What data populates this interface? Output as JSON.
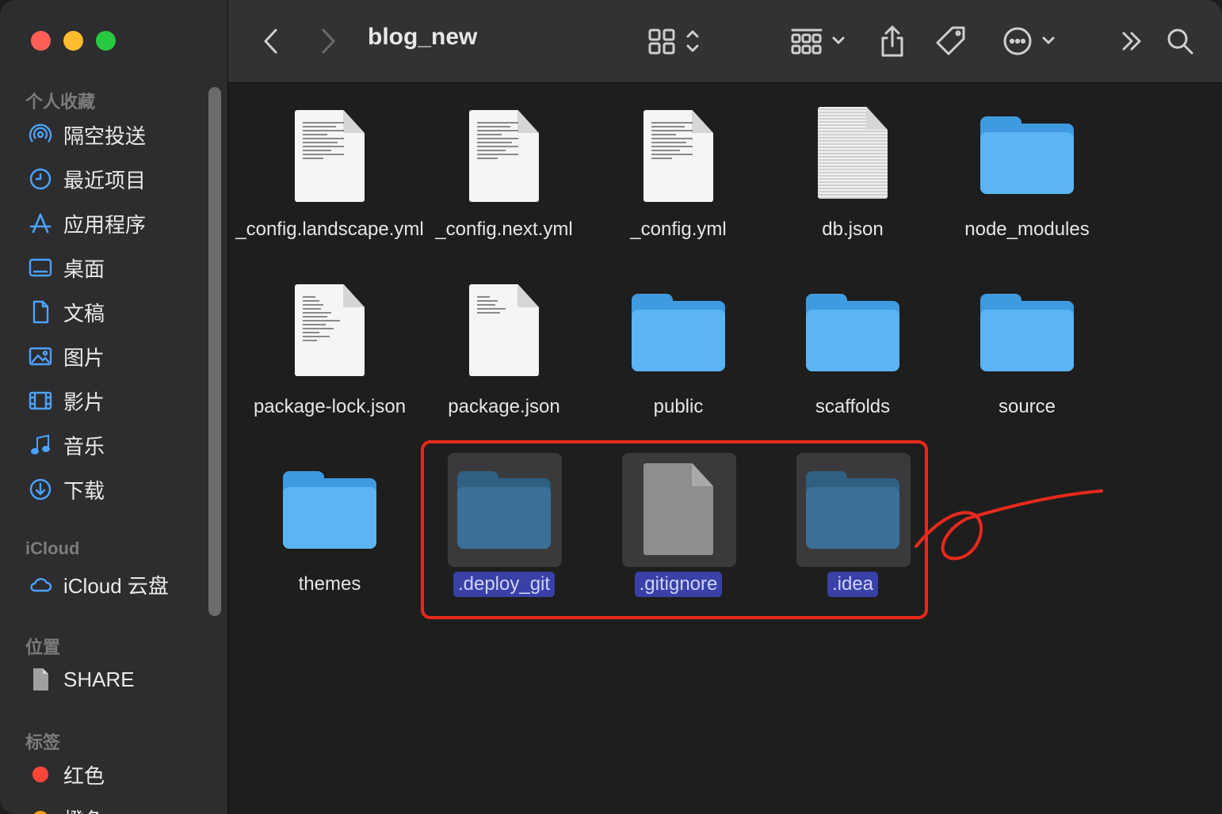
{
  "window": {
    "title": "blog_new"
  },
  "sidebar": {
    "favorites_title": "个人收藏",
    "favorites": [
      {
        "label": "隔空投送",
        "icon": "airdrop-icon"
      },
      {
        "label": "最近项目",
        "icon": "clock-icon"
      },
      {
        "label": "应用程序",
        "icon": "applications-icon"
      },
      {
        "label": "桌面",
        "icon": "desktop-icon"
      },
      {
        "label": "文稿",
        "icon": "document-icon"
      },
      {
        "label": "图片",
        "icon": "photo-icon"
      },
      {
        "label": "影片",
        "icon": "film-icon"
      },
      {
        "label": "音乐",
        "icon": "music-icon"
      },
      {
        "label": "下载",
        "icon": "download-icon"
      }
    ],
    "icloud_title": "iCloud",
    "icloud": [
      {
        "label": "iCloud 云盘",
        "icon": "cloud-icon"
      }
    ],
    "locations_title": "位置",
    "locations": [
      {
        "label": "SHARE",
        "icon": "share-file-icon"
      }
    ],
    "tags_title": "标签",
    "tags": [
      {
        "label": "红色",
        "color": "#ff453a"
      },
      {
        "label": "橙色",
        "color": "#ff9f0a"
      }
    ]
  },
  "files": [
    {
      "name": "_config.landscape.yml",
      "kind": "text-document"
    },
    {
      "name": "_config.next.yml",
      "kind": "text-document"
    },
    {
      "name": "_config.yml",
      "kind": "text-document"
    },
    {
      "name": "db.json",
      "kind": "dense-document"
    },
    {
      "name": "node_modules",
      "kind": "folder"
    },
    {
      "name": "package-lock.json",
      "kind": "code-document"
    },
    {
      "name": "package.json",
      "kind": "code-document"
    },
    {
      "name": "public",
      "kind": "folder"
    },
    {
      "name": "scaffolds",
      "kind": "folder"
    },
    {
      "name": "source",
      "kind": "folder"
    },
    {
      "name": "themes",
      "kind": "folder"
    },
    {
      "name": ".deploy_git",
      "kind": "folder",
      "selected": true
    },
    {
      "name": ".gitignore",
      "kind": "document",
      "selected": true
    },
    {
      "name": ".idea",
      "kind": "folder",
      "selected": true
    }
  ],
  "colors": {
    "accent_selection": "#3a41a6",
    "annotation": "#e8291c",
    "folder": "#5bb4f3"
  }
}
